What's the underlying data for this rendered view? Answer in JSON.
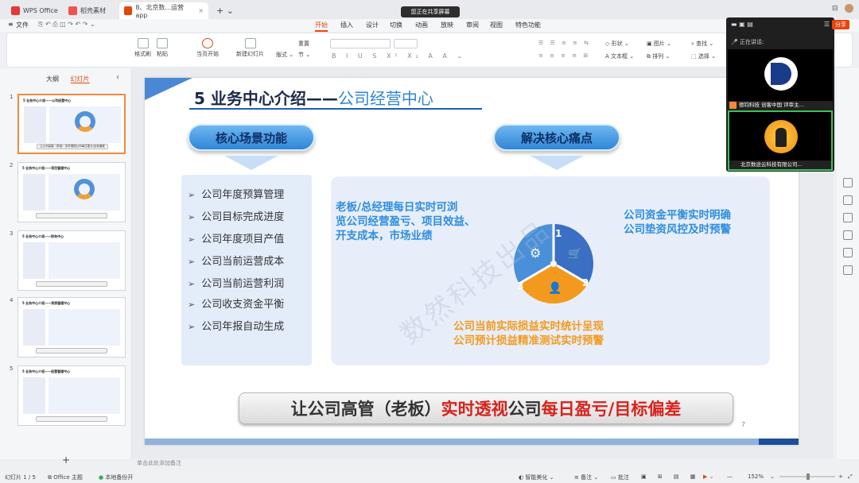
{
  "tabs": [
    {
      "label": "WPS Office"
    },
    {
      "label": "稻壳素材"
    },
    {
      "label": "8、北京数...运营app"
    }
  ],
  "share_banner": "您正在共享屏幕",
  "menu": {
    "file": "文件",
    "items": [
      "开始",
      "插入",
      "设计",
      "切换",
      "动画",
      "放映",
      "审阅",
      "视图",
      "特色功能"
    ],
    "active": "开始"
  },
  "toolbar": {
    "format_brush": "格式刷",
    "paste": "粘贴",
    "play_from_current": "当页开始",
    "new_slide": "新建幻灯片",
    "layout": "版式",
    "section": "节",
    "reset": "重置",
    "shape": "形状",
    "picture": "图片",
    "textbox": "文本框",
    "arrange": "排列",
    "find": "查找",
    "select": "选择"
  },
  "left_panel": {
    "outline_tab": "大纲",
    "slides_tab": "幻灯片",
    "numbers": [
      "1",
      "2",
      "3",
      "4",
      "5"
    ]
  },
  "slide": {
    "title_part1": "5 业务中心介绍——",
    "title_part2": "公司经营中心",
    "pill_left": "核心场景功能",
    "pill_right": "解决核心痛点",
    "list": [
      "公司年度预算管理",
      "公司目标完成进度",
      "公司年度项目产值",
      "公司当前运营成本",
      "公司当前运营利润",
      "公司收支资金平衡",
      "公司年报自动生成"
    ],
    "pain_top_left": [
      "老板/总经理每日实时可浏",
      "览公司经营盈亏、项目效益、",
      "开支成本，市场业绩"
    ],
    "pain_top_right": [
      "公司资金平衡实时明确",
      "公司垫资风控及时预警"
    ],
    "pain_bottom": [
      "公司当前实际损益实时统计呈现",
      "公司预计损益精准测试实时预警"
    ],
    "cycle_numbers": [
      "1",
      "2",
      "3"
    ],
    "watermark": "数然科技出品",
    "banner_part1": "让公司高管（老板）",
    "banner_part2": "实时透视",
    "banner_part3": "公司",
    "banner_part4": "每日盈亏/目标偏差",
    "page_number": "7"
  },
  "meeting": {
    "speaking_label": "正在讲话:",
    "participant1": "德钧科技 创客中国 评审主...",
    "participant2": "北京数途云科技有限公司..."
  },
  "notes_placeholder": "单击此处添加备注",
  "status": {
    "slide_info": "幻灯片 1 / 5",
    "theme": "Office 主题",
    "backup": "本地备份开",
    "beautify": "智能美化",
    "notes": "备注",
    "comments": "批注",
    "zoom": "152%"
  },
  "share_button": "分享"
}
